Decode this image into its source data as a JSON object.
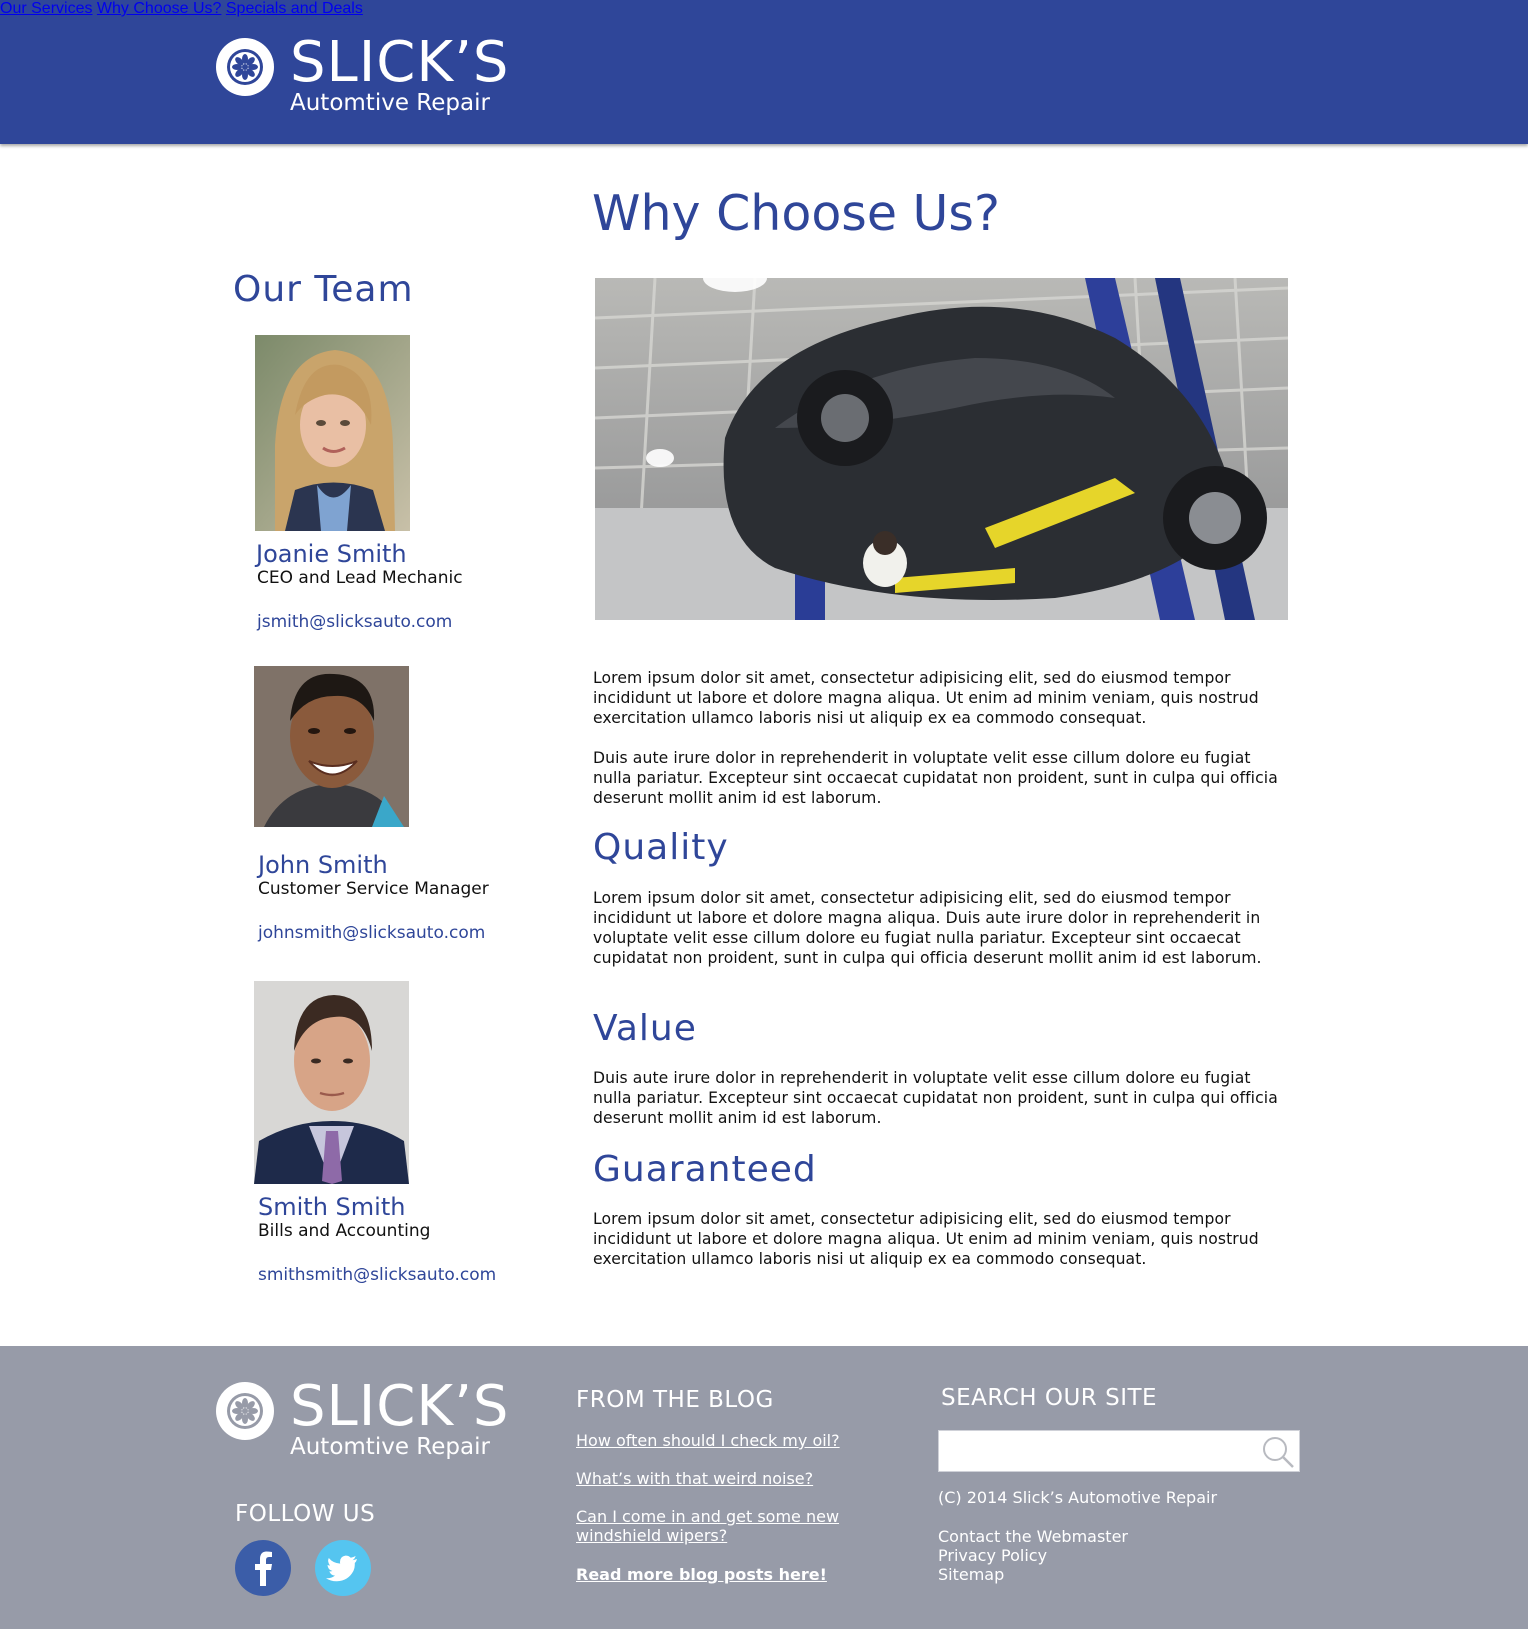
{
  "header": {
    "logo": {
      "title": "SLICK’S",
      "subtitle": "Automtive Repair"
    },
    "nav": [
      {
        "label": "Our Services"
      },
      {
        "label": "Why Choose Us?"
      },
      {
        "label": "Specials and Deals"
      }
    ]
  },
  "sidebar": {
    "title": "Our Team",
    "members": [
      {
        "name": "Joanie Smith",
        "role": "CEO and Lead Mechanic",
        "email": "jsmith@slicksauto.com"
      },
      {
        "name": "John Smith",
        "role": "Customer Service Manager",
        "email": "johnsmith@slicksauto.com"
      },
      {
        "name": "Smith Smith",
        "role": "Bills and Accounting",
        "email": "smithsmith@slicksauto.com"
      }
    ]
  },
  "main": {
    "title": "Why Choose Us?",
    "intro": [
      "Lorem ipsum dolor sit amet, consectetur adipisicing elit, sed do eiusmod tempor incididunt ut labore et dolore magna aliqua. Ut enim ad minim veniam, quis nostrud exercitation ullamco laboris nisi ut aliquip ex ea commodo consequat.",
      "Duis aute irure dolor in reprehenderit in voluptate velit esse cillum dolore eu fugiat nulla pariatur. Excepteur sint occaecat cupidatat non proident, sunt in culpa qui officia deserunt mollit anim id est laborum."
    ],
    "sections": [
      {
        "title": "Quality",
        "text": "Lorem ipsum dolor sit amet, consectetur adipisicing elit, sed do eiusmod tempor incididunt ut labore et dolore magna aliqua. Duis aute irure dolor in reprehenderit in voluptate velit esse cillum dolore eu fugiat nulla pariatur. Excepteur sint occaecat cupidatat non proident, sunt in culpa qui officia deserunt mollit anim id est laborum."
      },
      {
        "title": "Value",
        "text": "Duis aute irure dolor in reprehenderit in voluptate velit esse cillum dolore eu fugiat nulla pariatur. Excepteur sint occaecat cupidatat non proident, sunt in culpa qui officia deserunt mollit anim id est laborum."
      },
      {
        "title": "Guaranteed",
        "text": "Lorem ipsum dolor sit amet, consectetur adipisicing elit, sed do eiusmod tempor incididunt ut labore et dolore magna aliqua. Ut enim ad minim veniam, quis nostrud exercitation ullamco laboris nisi ut aliquip ex ea commodo consequat."
      }
    ]
  },
  "footer": {
    "logo": {
      "title": "SLICK’S",
      "subtitle": "Automtive Repair"
    },
    "follow_heading": "FOLLOW US",
    "social": [
      {
        "icon": "facebook-icon",
        "color": "#3b5da8"
      },
      {
        "icon": "twitter-icon",
        "color": "#55c5f0"
      }
    ],
    "blog_heading": "FROM THE BLOG",
    "blog_links": [
      "How often should I check my oil?",
      "What’s with that weird noise?",
      "Can I come in and get some new windshield wipers?",
      "Read more blog posts here!"
    ],
    "search_heading": "SEARCH OUR SITE",
    "search_value": "",
    "copyright": "(C) 2014 Slick’s Automotive Repair",
    "links": [
      "Contact the Webmaster",
      "Privacy Policy",
      "Sitemap"
    ]
  },
  "colors": {
    "brand_blue": "#2f4699",
    "footer_gray": "#979ba8",
    "facebook_blue": "#3b5da8",
    "twitter_blue": "#55c5f0"
  }
}
